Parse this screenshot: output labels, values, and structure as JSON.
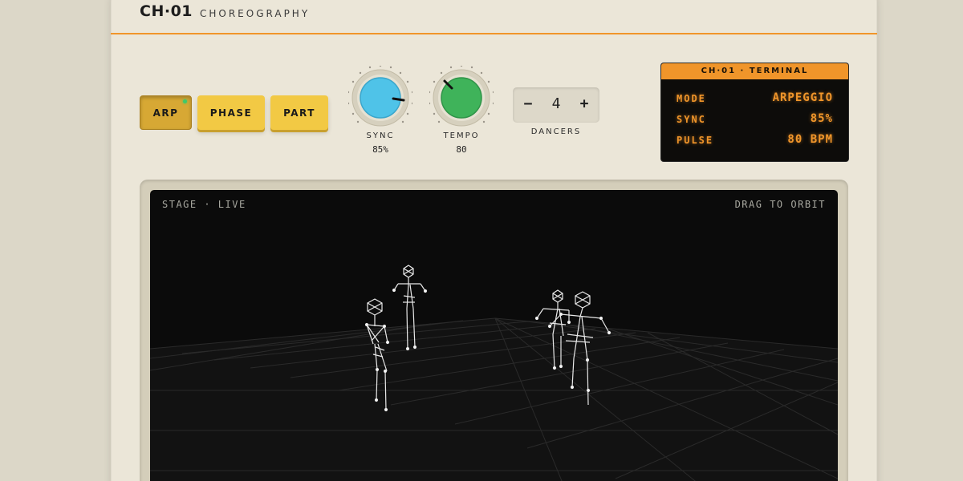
{
  "header": {
    "brand": "CH·01",
    "subtitle": "CHOREOGRAPHY"
  },
  "modes": [
    {
      "label": "ARP",
      "active": true
    },
    {
      "label": "PHASE",
      "active": false
    },
    {
      "label": "PART",
      "active": false
    }
  ],
  "knobs": {
    "sync": {
      "label": "SYNC",
      "value": "85%",
      "color": "#4fc3e8"
    },
    "tempo": {
      "label": "TEMPO",
      "value": "80",
      "color": "#3fb35a"
    }
  },
  "dancers": {
    "minus": "−",
    "value": "4",
    "plus": "+",
    "label": "DANCERS"
  },
  "terminal": {
    "title": "CH·01 · TERMINAL",
    "rows": [
      {
        "key": "MODE",
        "value": "ARPEGGIO"
      },
      {
        "key": "SYNC",
        "value": "85%"
      },
      {
        "key": "PULSE",
        "value": "80 BPM"
      }
    ]
  },
  "stage": {
    "left_label": "STAGE · LIVE",
    "right_label": "DRAG TO ORBIT",
    "dancer_count": 4
  },
  "colors": {
    "accent": "#f0952a",
    "button_yellow": "#f2c944",
    "led": "#3ec96a"
  }
}
